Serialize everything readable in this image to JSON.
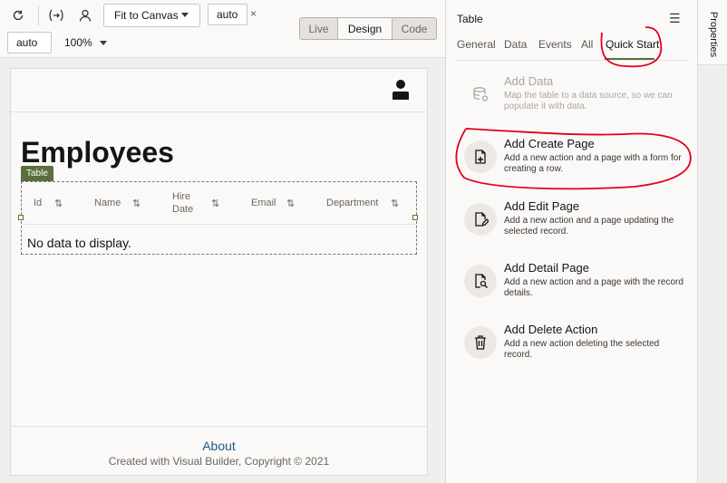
{
  "toolbar": {
    "fit_label": "Fit to Canvas",
    "width_value": "auto",
    "height_value": "auto",
    "clear_mark": "×",
    "zoom_label": "100%",
    "modes": [
      "Live",
      "Design",
      "Code"
    ],
    "active_mode": "Design"
  },
  "page": {
    "title": "Employees",
    "table_tag": "Table",
    "columns": [
      "Id",
      "Name",
      "Hire Date",
      "Email",
      "Department"
    ],
    "sort_glyph": "⇅",
    "empty_message": "No data to display.",
    "footer_link": "About",
    "footer_copyright": "Created with Visual Builder, Copyright © 2021"
  },
  "panel": {
    "title": "Table",
    "tabs": [
      "General",
      "Data",
      "Events",
      "All",
      "Quick Start"
    ],
    "active_tab": "Quick Start",
    "quick_start": [
      {
        "title": "Add Data",
        "desc": "Map the table to a data source, so we can populate it with data.",
        "icon": "database-icon",
        "disabled": true
      },
      {
        "title": "Add Create Page",
        "desc": "Add a new action and a page with a form for creating a row.",
        "icon": "page-add-icon",
        "disabled": false
      },
      {
        "title": "Add Edit Page",
        "desc": "Add a new action and a page updating the selected record.",
        "icon": "page-edit-icon",
        "disabled": false
      },
      {
        "title": "Add Detail Page",
        "desc": "Add a new action and a page with the record details.",
        "icon": "page-search-icon",
        "disabled": false
      },
      {
        "title": "Add Delete Action",
        "desc": "Add a new action deleting the selected record.",
        "icon": "trash-icon",
        "disabled": false
      }
    ]
  },
  "rail": {
    "label": "Properties"
  },
  "colors": {
    "accent": "#5b6f3d",
    "annotation": "#e3001b",
    "link": "#1a5a8a"
  }
}
